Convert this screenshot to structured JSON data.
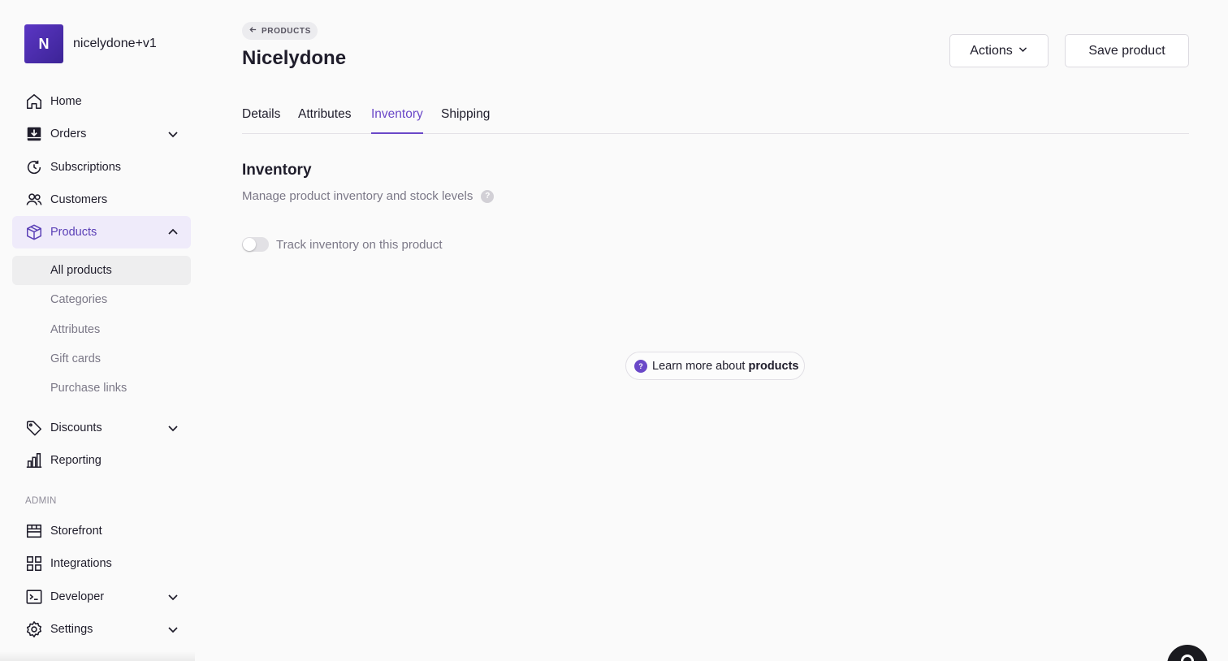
{
  "store": {
    "initial": "N",
    "name": "nicelydone+v1"
  },
  "sidebar": {
    "items": [
      {
        "label": "Home",
        "icon": "home-icon"
      },
      {
        "label": "Orders",
        "icon": "orders-icon",
        "expandable": true
      },
      {
        "label": "Subscriptions",
        "icon": "subscriptions-icon"
      },
      {
        "label": "Customers",
        "icon": "customers-icon"
      },
      {
        "label": "Products",
        "icon": "box-icon",
        "expanded": true,
        "active": true
      },
      {
        "label": "Discounts",
        "icon": "tag-icon",
        "expandable": true
      },
      {
        "label": "Reporting",
        "icon": "bar-chart-icon"
      }
    ],
    "products_sub": [
      {
        "label": "All products",
        "selected": true
      },
      {
        "label": "Categories"
      },
      {
        "label": "Attributes"
      },
      {
        "label": "Gift cards"
      },
      {
        "label": "Purchase links"
      }
    ],
    "admin_label": "ADMIN",
    "admin_items": [
      {
        "label": "Storefront",
        "icon": "storefront-icon"
      },
      {
        "label": "Integrations",
        "icon": "grid-icon"
      },
      {
        "label": "Developer",
        "icon": "terminal-icon",
        "expandable": true
      },
      {
        "label": "Settings",
        "icon": "gear-icon",
        "expandable": true
      }
    ]
  },
  "header": {
    "breadcrumb": "PRODUCTS",
    "title": "Nicelydone",
    "actions_label": "Actions",
    "save_label": "Save product"
  },
  "tabs": [
    {
      "label": "Details"
    },
    {
      "label": "Attributes"
    },
    {
      "label": "Inventory",
      "active": true
    },
    {
      "label": "Shipping"
    }
  ],
  "inventory": {
    "title": "Inventory",
    "description": "Manage product inventory and stock levels",
    "toggle_label": "Track inventory on this product",
    "toggle_on": false
  },
  "learn_more": {
    "prefix": "Learn more about",
    "emphasis": "products"
  },
  "colors": {
    "accent": "#6a48c8",
    "active_bg": "#efebfa",
    "avatar": "#4a2bb0"
  }
}
